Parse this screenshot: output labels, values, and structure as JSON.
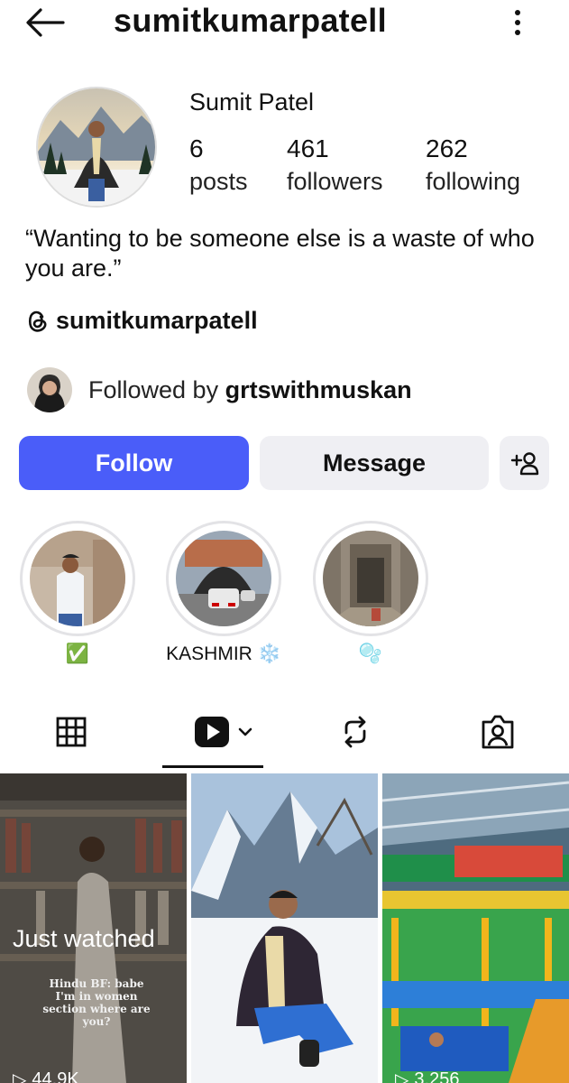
{
  "header": {
    "username": "sumitkumarpatell"
  },
  "profile": {
    "name": "Sumit Patel",
    "stats": [
      {
        "value": "6",
        "label": "posts"
      },
      {
        "value": "461",
        "label": "followers"
      },
      {
        "value": "262",
        "label": "following"
      }
    ],
    "bio": "“Wanting to be someone else is a waste of who you are.”",
    "threads_handle": "sumitkumarpatell",
    "followed_by_prefix": "Followed by ",
    "followed_by_user": "grtswithmuskan"
  },
  "actions": {
    "follow": "Follow",
    "message": "Message"
  },
  "highlights": [
    {
      "label": "✅"
    },
    {
      "label": "KASHMIR ❄️"
    },
    {
      "label": "🫧"
    }
  ],
  "tabs": [
    "grid-icon",
    "reels-icon",
    "reposts-icon",
    "tagged-icon"
  ],
  "grid": {
    "just_watched": "Just watched",
    "overlay_text": "Hindu BF: babe I'm in women section where are you?",
    "views": [
      "44.9K",
      "3,256"
    ]
  },
  "colors": {
    "primary": "#4a5df9",
    "secondary_bg": "#efeff3"
  }
}
